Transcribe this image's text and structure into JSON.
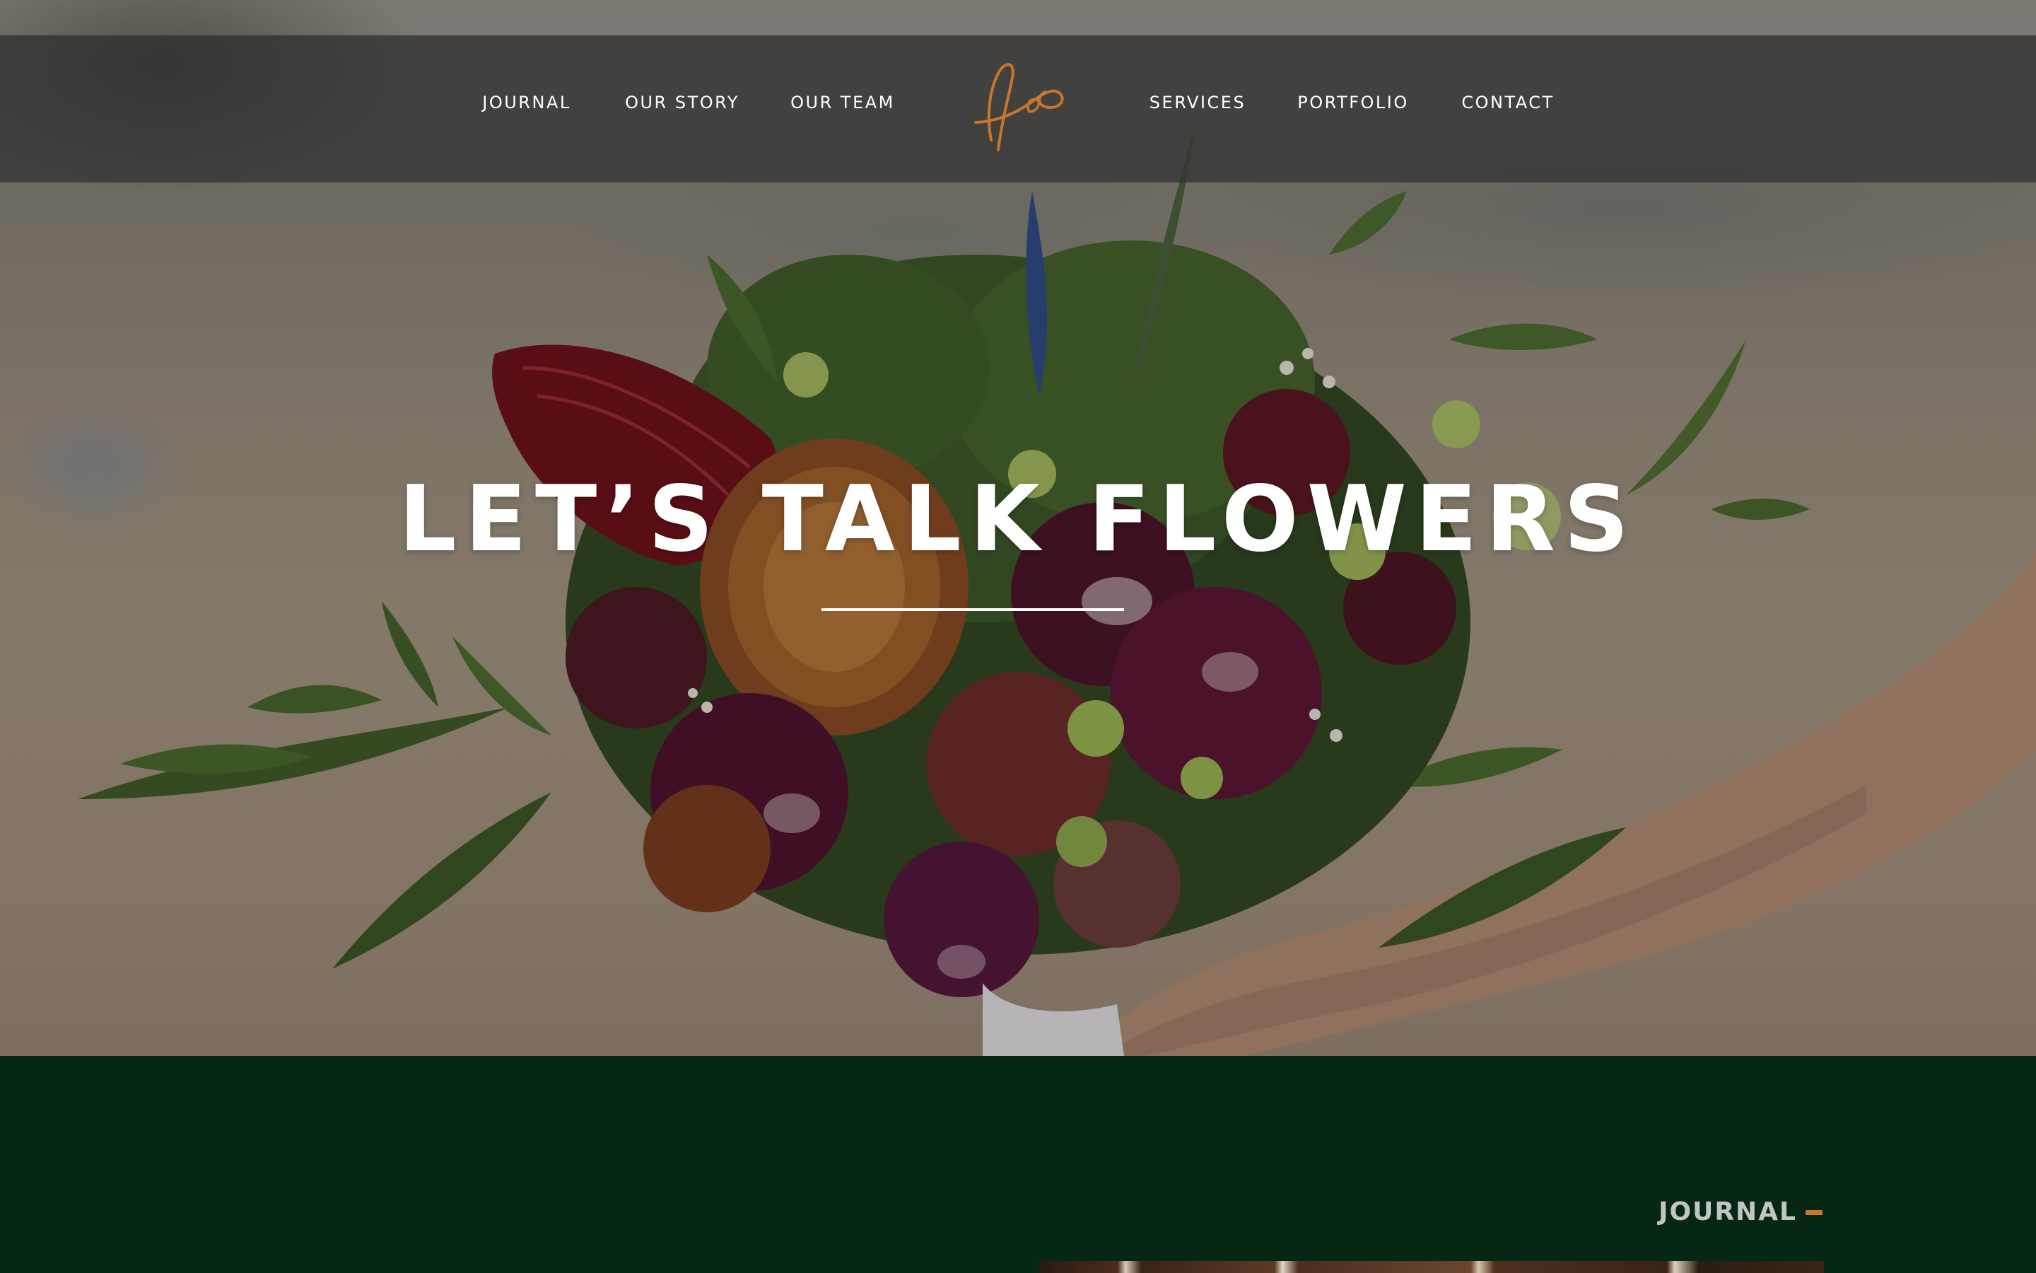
{
  "nav": {
    "left": [
      "JOURNAL",
      "OUR STORY",
      "OUR TEAM"
    ],
    "right": [
      "SERVICES",
      "PORTFOLIO",
      "CONTACT"
    ],
    "logo_icon": "script-monogram-logo"
  },
  "hero": {
    "title": "LET’S TALK FLOWERS",
    "background": "bridal-bouquet-photo"
  },
  "journal": {
    "label": "JOURNAL"
  },
  "colors": {
    "accent": "#c9752c",
    "section_bg": "#052713",
    "nav_bg": "#343434",
    "text": "#ffffff"
  }
}
